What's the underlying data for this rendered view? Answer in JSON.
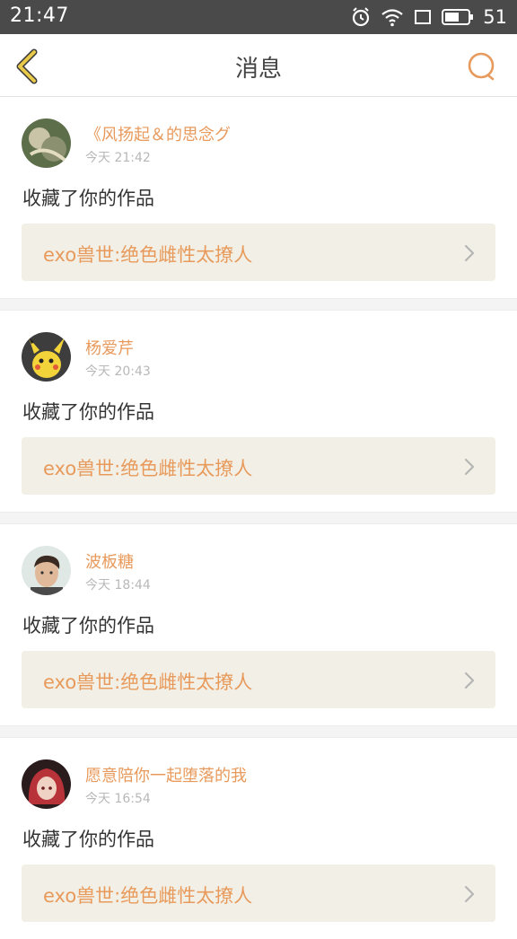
{
  "status_bar": {
    "time": "21:47",
    "battery_level": "51",
    "icons": [
      "alarm-icon",
      "wifi-icon",
      "sim-icon",
      "battery-icon"
    ]
  },
  "nav": {
    "title": "消息",
    "back_icon": "chevron-left-icon",
    "search_icon": "search-icon"
  },
  "colors": {
    "accent": "#e89a5c",
    "back_chevron": "#e8c94a",
    "status_bar": "#4a4a4a",
    "work_box": "#f2f0e6"
  },
  "messages": [
    {
      "username": "《风扬起＆的思念グ",
      "time": "今天 21:42",
      "action": "收藏了你的作品",
      "work_title": "exo兽世:绝色雌性太撩人"
    },
    {
      "username": "杨爱芹",
      "time": "今天 20:43",
      "action": "收藏了你的作品",
      "work_title": "exo兽世:绝色雌性太撩人"
    },
    {
      "username": "波板糖",
      "time": "今天 18:44",
      "action": "收藏了你的作品",
      "work_title": "exo兽世:绝色雌性太撩人"
    },
    {
      "username": "愿意陪你一起堕落的我",
      "time": "今天 16:54",
      "action": "收藏了你的作品",
      "work_title": "exo兽世:绝色雌性太撩人"
    }
  ]
}
